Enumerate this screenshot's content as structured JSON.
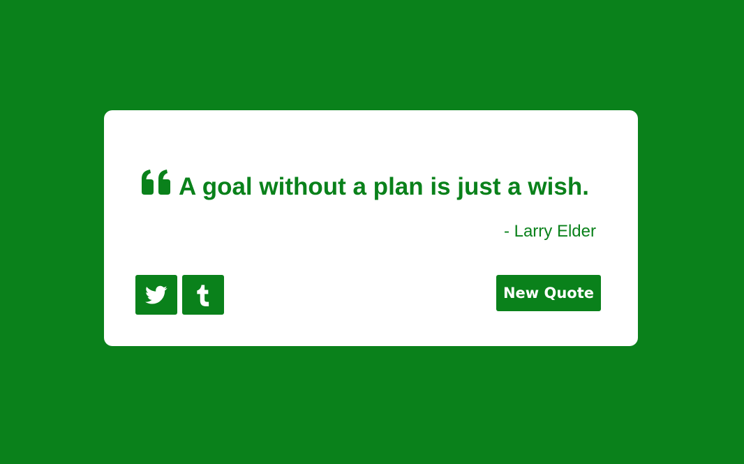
{
  "quote": {
    "text": "A goal without a plan is just a wish.",
    "author": "- Larry Elder",
    "icon": "quote-left-icon"
  },
  "actions": {
    "twitter_icon": "twitter-icon",
    "tumblr_icon": "tumblr-icon",
    "new_quote_label": "New Quote"
  },
  "colors": {
    "background": "#0a811b",
    "card": "#ffffff",
    "accent": "#0a811b",
    "button_text": "#ffffff"
  }
}
